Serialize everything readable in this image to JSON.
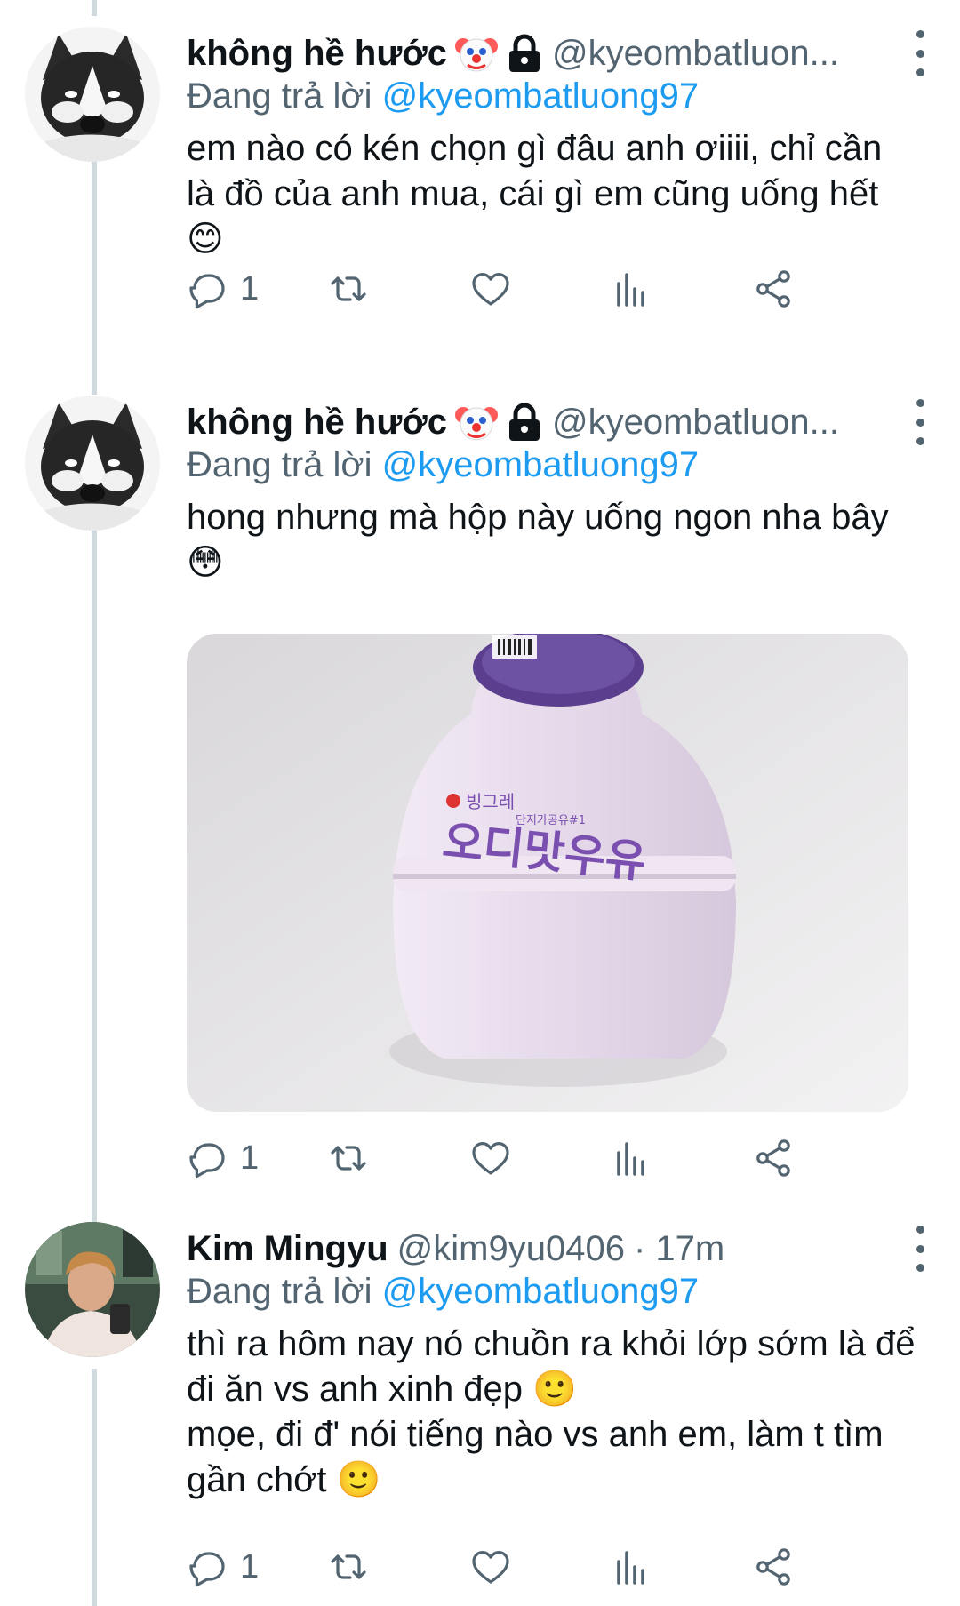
{
  "tweets": [
    {
      "name": "không hề hước",
      "handle": "@kyeombatluon...",
      "time": "",
      "replying_prefix": "Đang trả lời",
      "replying_to": "@kyeombatluong97",
      "text_lines": [
        "em nào có kén chọn gì đâu anh ơiiii, chỉ cần là đồ của anh mua, cái gì em cũng uống hết 😊"
      ],
      "reply_count": "1",
      "avatar": "husky-dog-avatar",
      "badges": [
        "clown-emoji",
        "lock-icon"
      ]
    },
    {
      "name": "không hề hước",
      "handle": "@kyeombatluon...",
      "time": "",
      "replying_prefix": "Đang trả lời",
      "replying_to": "@kyeombatluong97",
      "text_lines": [
        "hong nhưng mà hộp này uống ngon nha bây 😳"
      ],
      "reply_count": "1",
      "avatar": "husky-dog-avatar",
      "badges": [
        "clown-emoji",
        "lock-icon"
      ],
      "media": {
        "label_top": "빙그레",
        "label_small": "단지가공유#1",
        "label_main": "오디맛우유",
        "bottle_color": "#e7ddec",
        "cap_color": "#5b3f8e",
        "text_color": "#7a4fb0"
      }
    },
    {
      "name": "Kim Mingyu",
      "handle": "@kim9yu0406",
      "time": "· 17m",
      "replying_prefix": "Đang trả lời",
      "replying_to": "@kyeombatluong97",
      "text_lines": [
        "thì ra hôm nay nó chuồn ra khỏi lớp sớm là để đi ăn vs anh xinh đẹp 🙂",
        "mọe, đi đ' nói tiếng nào vs anh em, làm t tìm gần chớt 🙂"
      ],
      "reply_count": "1",
      "avatar": "person-photo-avatar",
      "badges": []
    }
  ],
  "colors": {
    "link": "#1d9bf0",
    "secondary": "#536471",
    "thread_line": "#cfd9de"
  }
}
